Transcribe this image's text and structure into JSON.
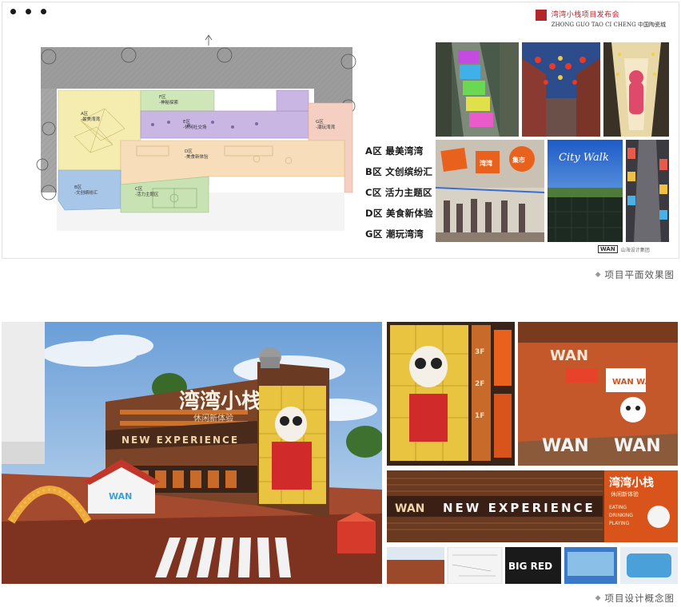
{
  "brand": {
    "cn": "湾湾小栈项目发布会",
    "en": "ZHONG GUO TAO CI CHENG 中国陶瓷城"
  },
  "plan": {
    "zones": [
      {
        "id": "A",
        "name": "A区",
        "sub": "-最美湾湾"
      },
      {
        "id": "B",
        "name": "B区",
        "sub": "-文创缤纷汇"
      },
      {
        "id": "C",
        "name": "C区",
        "sub": "-活力主题区"
      },
      {
        "id": "D",
        "name": "D区",
        "sub": "-美食新体验"
      },
      {
        "id": "E",
        "name": "E区",
        "sub": "-休闲社交场"
      },
      {
        "id": "F",
        "name": "F区",
        "sub": "-神秘探索"
      },
      {
        "id": "G",
        "name": "G区",
        "sub": "-潮玩湾湾"
      }
    ],
    "colors": {
      "A": "#f5ecb0",
      "B": "#a8c6e8",
      "C": "#c8e2b4",
      "D": "#f7ddb9",
      "E": "#c9b6e2",
      "F": "#cfe6b8",
      "G": "#f5cfc1"
    }
  },
  "legend": [
    "A区 最美湾湾",
    "B区 文创缤纷汇",
    "C区 活力主题区",
    "D区 美食新体验",
    "G区 潮玩湾湾"
  ],
  "plan_logo": {
    "mark": "WAN",
    "text": "山海设计集团"
  },
  "captions": {
    "plan": "项目平面效果图",
    "concept": "项目设计概念图"
  },
  "concept": {
    "sign_main": "湾湾小栈",
    "sign_sub": "休闲新体验",
    "band": "NEW EXPERIENCE",
    "wan": "WAN",
    "wanwan": "WAN WAN",
    "floors": [
      "3F",
      "2F",
      "1F"
    ],
    "big_red": "BIG RED",
    "city_walk": "City Walk",
    "arch": "WAN",
    "board": [
      "EATING",
      "DRINKING",
      "PLAYING"
    ],
    "shop_boards": [
      "湾湾",
      "集市"
    ]
  }
}
